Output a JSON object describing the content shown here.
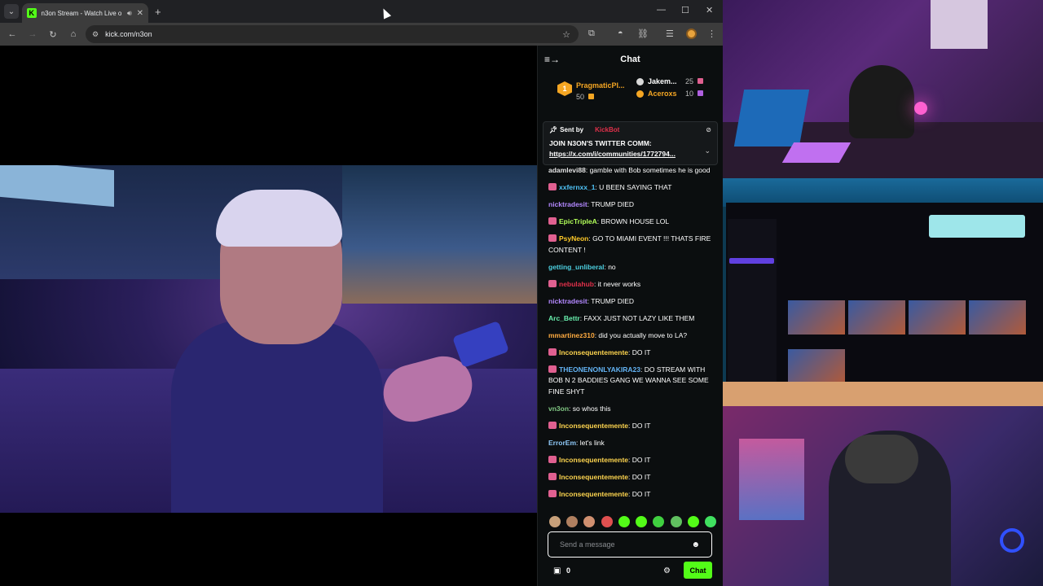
{
  "browser": {
    "tab_title": "n3on Stream - Watch Live o",
    "url": "kick.com/n3on"
  },
  "chat": {
    "title": "Chat",
    "leaderboard": [
      {
        "rank": "1",
        "name": "PragmaticPl...",
        "score": "50"
      },
      {
        "name": "Jakem...",
        "score": "25"
      },
      {
        "name": "Aceroxs",
        "score": "10"
      }
    ],
    "pinned": {
      "sent_by_label": "Sent by",
      "sender": "KickBot",
      "line1": "JOIN N3ON'S TWITTER COMM:",
      "link": "https://x.com/i/communities/1772794..."
    },
    "messages": [
      {
        "user": "adamlevi88",
        "color": "#e2e2e2",
        "badge": false,
        "text": ": gamble with Bob sometimes he is good"
      },
      {
        "user": "xxfernxx_1",
        "color": "#4fc3f7",
        "badge": true,
        "text": ": U BEEN SAYING THAT"
      },
      {
        "user": "nicktradesit",
        "color": "#b388ff",
        "badge": false,
        "text": ": TRUMP DIED"
      },
      {
        "user": "EpicTripleA",
        "color": "#b2ff59",
        "badge": true,
        "text": ": BROWN HOUSE LOL"
      },
      {
        "user": "PsyNeon",
        "color": "#ffca28",
        "badge": true,
        "text": ": GO TO MIAMI EVENT !!! THATS FIRE CONTENT !"
      },
      {
        "user": "getting_unliberal",
        "color": "#4dd0e1",
        "badge": false,
        "text": ": no"
      },
      {
        "user": "nebulahub",
        "color": "#e0304a",
        "badge": true,
        "text": ": it never works"
      },
      {
        "user": "nicktradesit",
        "color": "#b388ff",
        "badge": false,
        "text": ": TRUMP DIED"
      },
      {
        "user": "Arc_Bettr",
        "color": "#69f0ae",
        "badge": false,
        "text": ": FAXX JUST NOT LAZY LIKE THEM"
      },
      {
        "user": "mmartinez310",
        "color": "#ffab40",
        "badge": false,
        "text": ": did you actually move to LA?"
      },
      {
        "user": "Inconsequentemente",
        "color": "#ffd54f",
        "badge": true,
        "text": ": DO IT"
      },
      {
        "user": "THEONENONLYAKIRA23",
        "color": "#64b5f6",
        "badge": true,
        "text": ": DO STREAM WITH BOB N 2 BADDIES GANG WE WANNA SEE SOME FINE SHYT"
      },
      {
        "user": "vn3on",
        "color": "#81c784",
        "badge": false,
        "text": ": so whos this"
      },
      {
        "user": "Inconsequentemente",
        "color": "#ffd54f",
        "badge": true,
        "text": ": DO IT"
      },
      {
        "user": "ErrorEm",
        "color": "#90caf9",
        "badge": false,
        "text": ": let's link"
      },
      {
        "user": "Inconsequentemente",
        "color": "#ffd54f",
        "badge": true,
        "text": ": DO IT"
      },
      {
        "user": "Inconsequentemente",
        "color": "#ffd54f",
        "badge": true,
        "text": ": DO IT"
      },
      {
        "user": "Inconsequentemente",
        "color": "#ffd54f",
        "badge": true,
        "text": ": DO IT"
      }
    ],
    "input_placeholder": "Send a message",
    "store_count": "0",
    "send_label": "Chat"
  },
  "colors": {
    "kick_green": "#53fc18",
    "chat_bg": "#0b0e0f"
  }
}
